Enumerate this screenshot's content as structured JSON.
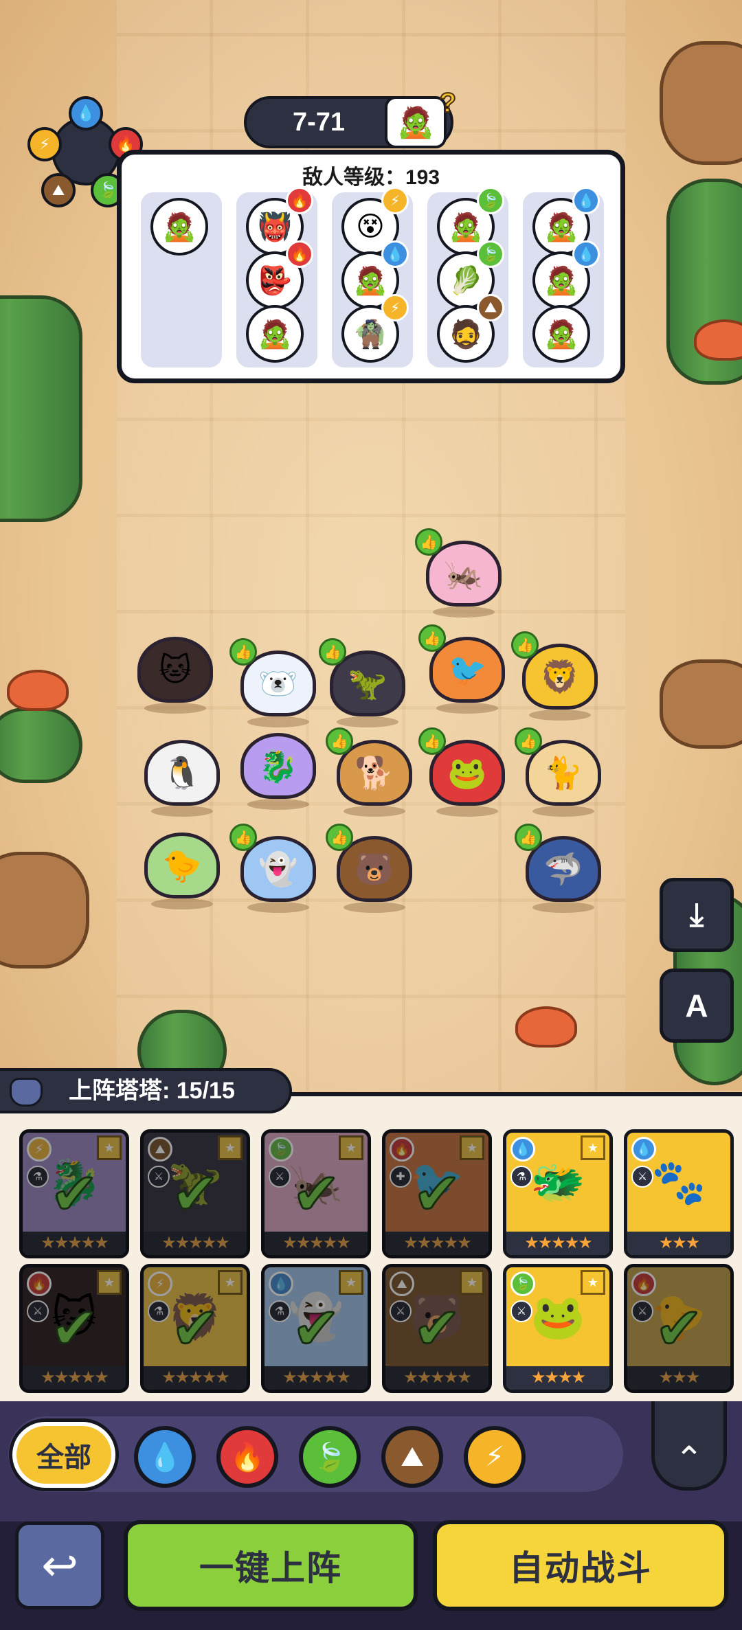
{
  "stage": {
    "label": "7-71",
    "boss_hint": "?"
  },
  "enemy_panel": {
    "title": "敌人等级：193"
  },
  "roster": {
    "title": "上阵塔塔: 15/15"
  },
  "filters": {
    "all_label": "全部"
  },
  "actions": {
    "auto_deploy": "一键上阵",
    "auto_battle": "自动战斗"
  },
  "side": {
    "auto_label": "A"
  },
  "colors": {
    "water": "#3d8fe0",
    "fire": "#e03a3a",
    "grass": "#5cbf3a",
    "earth": "#8a5a2e",
    "thunder": "#f6b428"
  },
  "icons": {
    "water": "💧",
    "fire": "🔥",
    "grass": "🍃",
    "earth": "⛰",
    "thunder": "⚡",
    "like": "👍",
    "check": "✔",
    "star": "★",
    "back": "↩",
    "up": "⌃",
    "download": "⤓"
  }
}
